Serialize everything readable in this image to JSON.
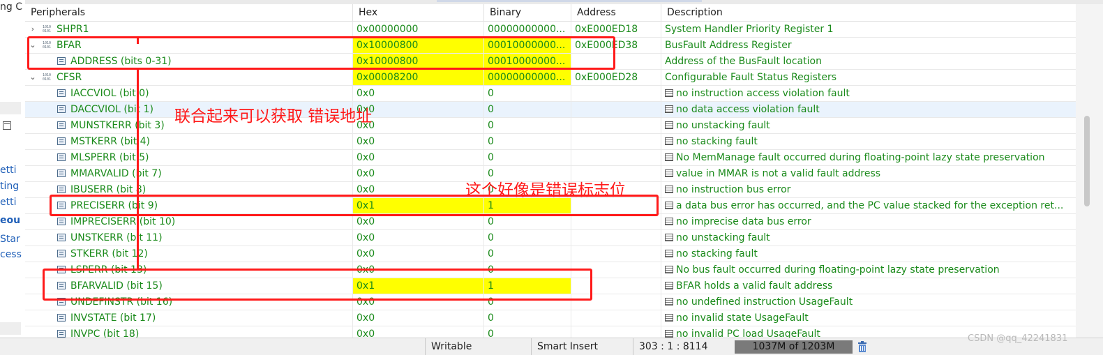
{
  "left_panel": {
    "top_text": "ng C",
    "items": [
      "etti",
      "ting",
      "etti",
      "eou",
      "Star",
      "cess"
    ]
  },
  "header": {
    "columns": [
      "Peripherals",
      "Hex",
      "Binary",
      "Address",
      "Description"
    ]
  },
  "rows": [
    {
      "name": "SHPR1",
      "kind": "group",
      "state": "collapsed",
      "hex": "0x00000000",
      "bin": "00000000000...",
      "addr": "0xE000ED18",
      "desc": "System Handler Priority Register 1",
      "hl": false
    },
    {
      "name": "BFAR",
      "kind": "group",
      "state": "expanded",
      "hex": "0x10000800",
      "bin": "00010000000...",
      "addr": "0xE000ED38",
      "desc": "BusFault Address Register",
      "hl": true
    },
    {
      "name": "ADDRESS (bits 0-31)",
      "kind": "field",
      "hex": "0x10000800",
      "bin": "00010000000...",
      "addr": "",
      "desc": "Address of the BusFault location",
      "hl": true
    },
    {
      "name": "CFSR",
      "kind": "group",
      "state": "expanded",
      "hex": "0x00008200",
      "bin": "00000000000...",
      "addr": "0xE000ED28",
      "desc": "Configurable Fault Status Registers",
      "hl": true
    },
    {
      "name": "IACCVIOL (bit 0)",
      "kind": "field",
      "hex": "0x0",
      "bin": "0",
      "addr": "",
      "desc": "no instruction access violation fault",
      "hl": false
    },
    {
      "name": "DACCVIOL (bit 1)",
      "kind": "field",
      "hex": "0x0",
      "bin": "0",
      "addr": "",
      "desc": "no data access violation fault",
      "hl": false,
      "selected": true
    },
    {
      "name": "MUNSTKERR (bit 3)",
      "kind": "field",
      "hex": "0x0",
      "bin": "0",
      "addr": "",
      "desc": "no unstacking fault",
      "hl": false
    },
    {
      "name": "MSTKERR (bit 4)",
      "kind": "field",
      "hex": "0x0",
      "bin": "0",
      "addr": "",
      "desc": "no stacking fault",
      "hl": false
    },
    {
      "name": "MLSPERR (bit 5)",
      "kind": "field",
      "hex": "0x0",
      "bin": "0",
      "addr": "",
      "desc": "No MemManage fault occurred during floating-point lazy state preservation",
      "hl": false
    },
    {
      "name": "MMARVALID (bit 7)",
      "kind": "field",
      "hex": "0x0",
      "bin": "0",
      "addr": "",
      "desc": "value in MMAR is not a valid fault address",
      "hl": false
    },
    {
      "name": "IBUSERR (bit 8)",
      "kind": "field",
      "hex": "0x0",
      "bin": "0",
      "addr": "",
      "desc": "no instruction bus error",
      "hl": false
    },
    {
      "name": "PRECISERR (bit 9)",
      "kind": "field",
      "hex": "0x1",
      "bin": "1",
      "addr": "",
      "desc": "a data bus error has occurred, and the PC value stacked for the exception ret...",
      "hl": true
    },
    {
      "name": "IMPRECISERR (bit 10)",
      "kind": "field",
      "hex": "0x0",
      "bin": "0",
      "addr": "",
      "desc": "no imprecise data bus error",
      "hl": false
    },
    {
      "name": "UNSTKERR (bit 11)",
      "kind": "field",
      "hex": "0x0",
      "bin": "0",
      "addr": "",
      "desc": "no unstacking fault",
      "hl": false
    },
    {
      "name": "STKERR (bit 12)",
      "kind": "field",
      "hex": "0x0",
      "bin": "0",
      "addr": "",
      "desc": "no stacking fault",
      "hl": false
    },
    {
      "name": "LSPERR (bit 13)",
      "kind": "field",
      "hex": "0x0",
      "bin": "0",
      "addr": "",
      "desc": "No bus fault occurred during floating-point lazy state preservation",
      "hl": false
    },
    {
      "name": "BFARVALID (bit 15)",
      "kind": "field",
      "hex": "0x1",
      "bin": "1",
      "addr": "",
      "desc": "BFAR holds a valid fault address",
      "hl": true
    },
    {
      "name": "UNDEFINSTR (bit 16)",
      "kind": "field",
      "hex": "0x0",
      "bin": "0",
      "addr": "",
      "desc": "no undefined instruction UsageFault",
      "hl": false
    },
    {
      "name": "INVSTATE (bit 17)",
      "kind": "field",
      "hex": "0x0",
      "bin": "0",
      "addr": "",
      "desc": "no invalid state UsageFault",
      "hl": false
    },
    {
      "name": "INVPC (bit 18)",
      "kind": "field",
      "hex": "0x0",
      "bin": "0",
      "addr": "",
      "desc": "no invalid PC load UsageFault",
      "hl": false
    }
  ],
  "annotations": {
    "combine_note": "联合起来可以获取  错误地址",
    "flag_note": "这个好像是错误标志位"
  },
  "statusbar": {
    "writable": "Writable",
    "insert_mode": "Smart Insert",
    "cursor": "303 : 1 : 8114",
    "memory": "1037M of 1203M"
  },
  "watermark": "CSDN @qq_42241831",
  "colors": {
    "value_text": "#1a8a1a",
    "highlight": "#ffff00",
    "annotation": "#ff1a1a",
    "selected_row": "#eaf3fd"
  }
}
